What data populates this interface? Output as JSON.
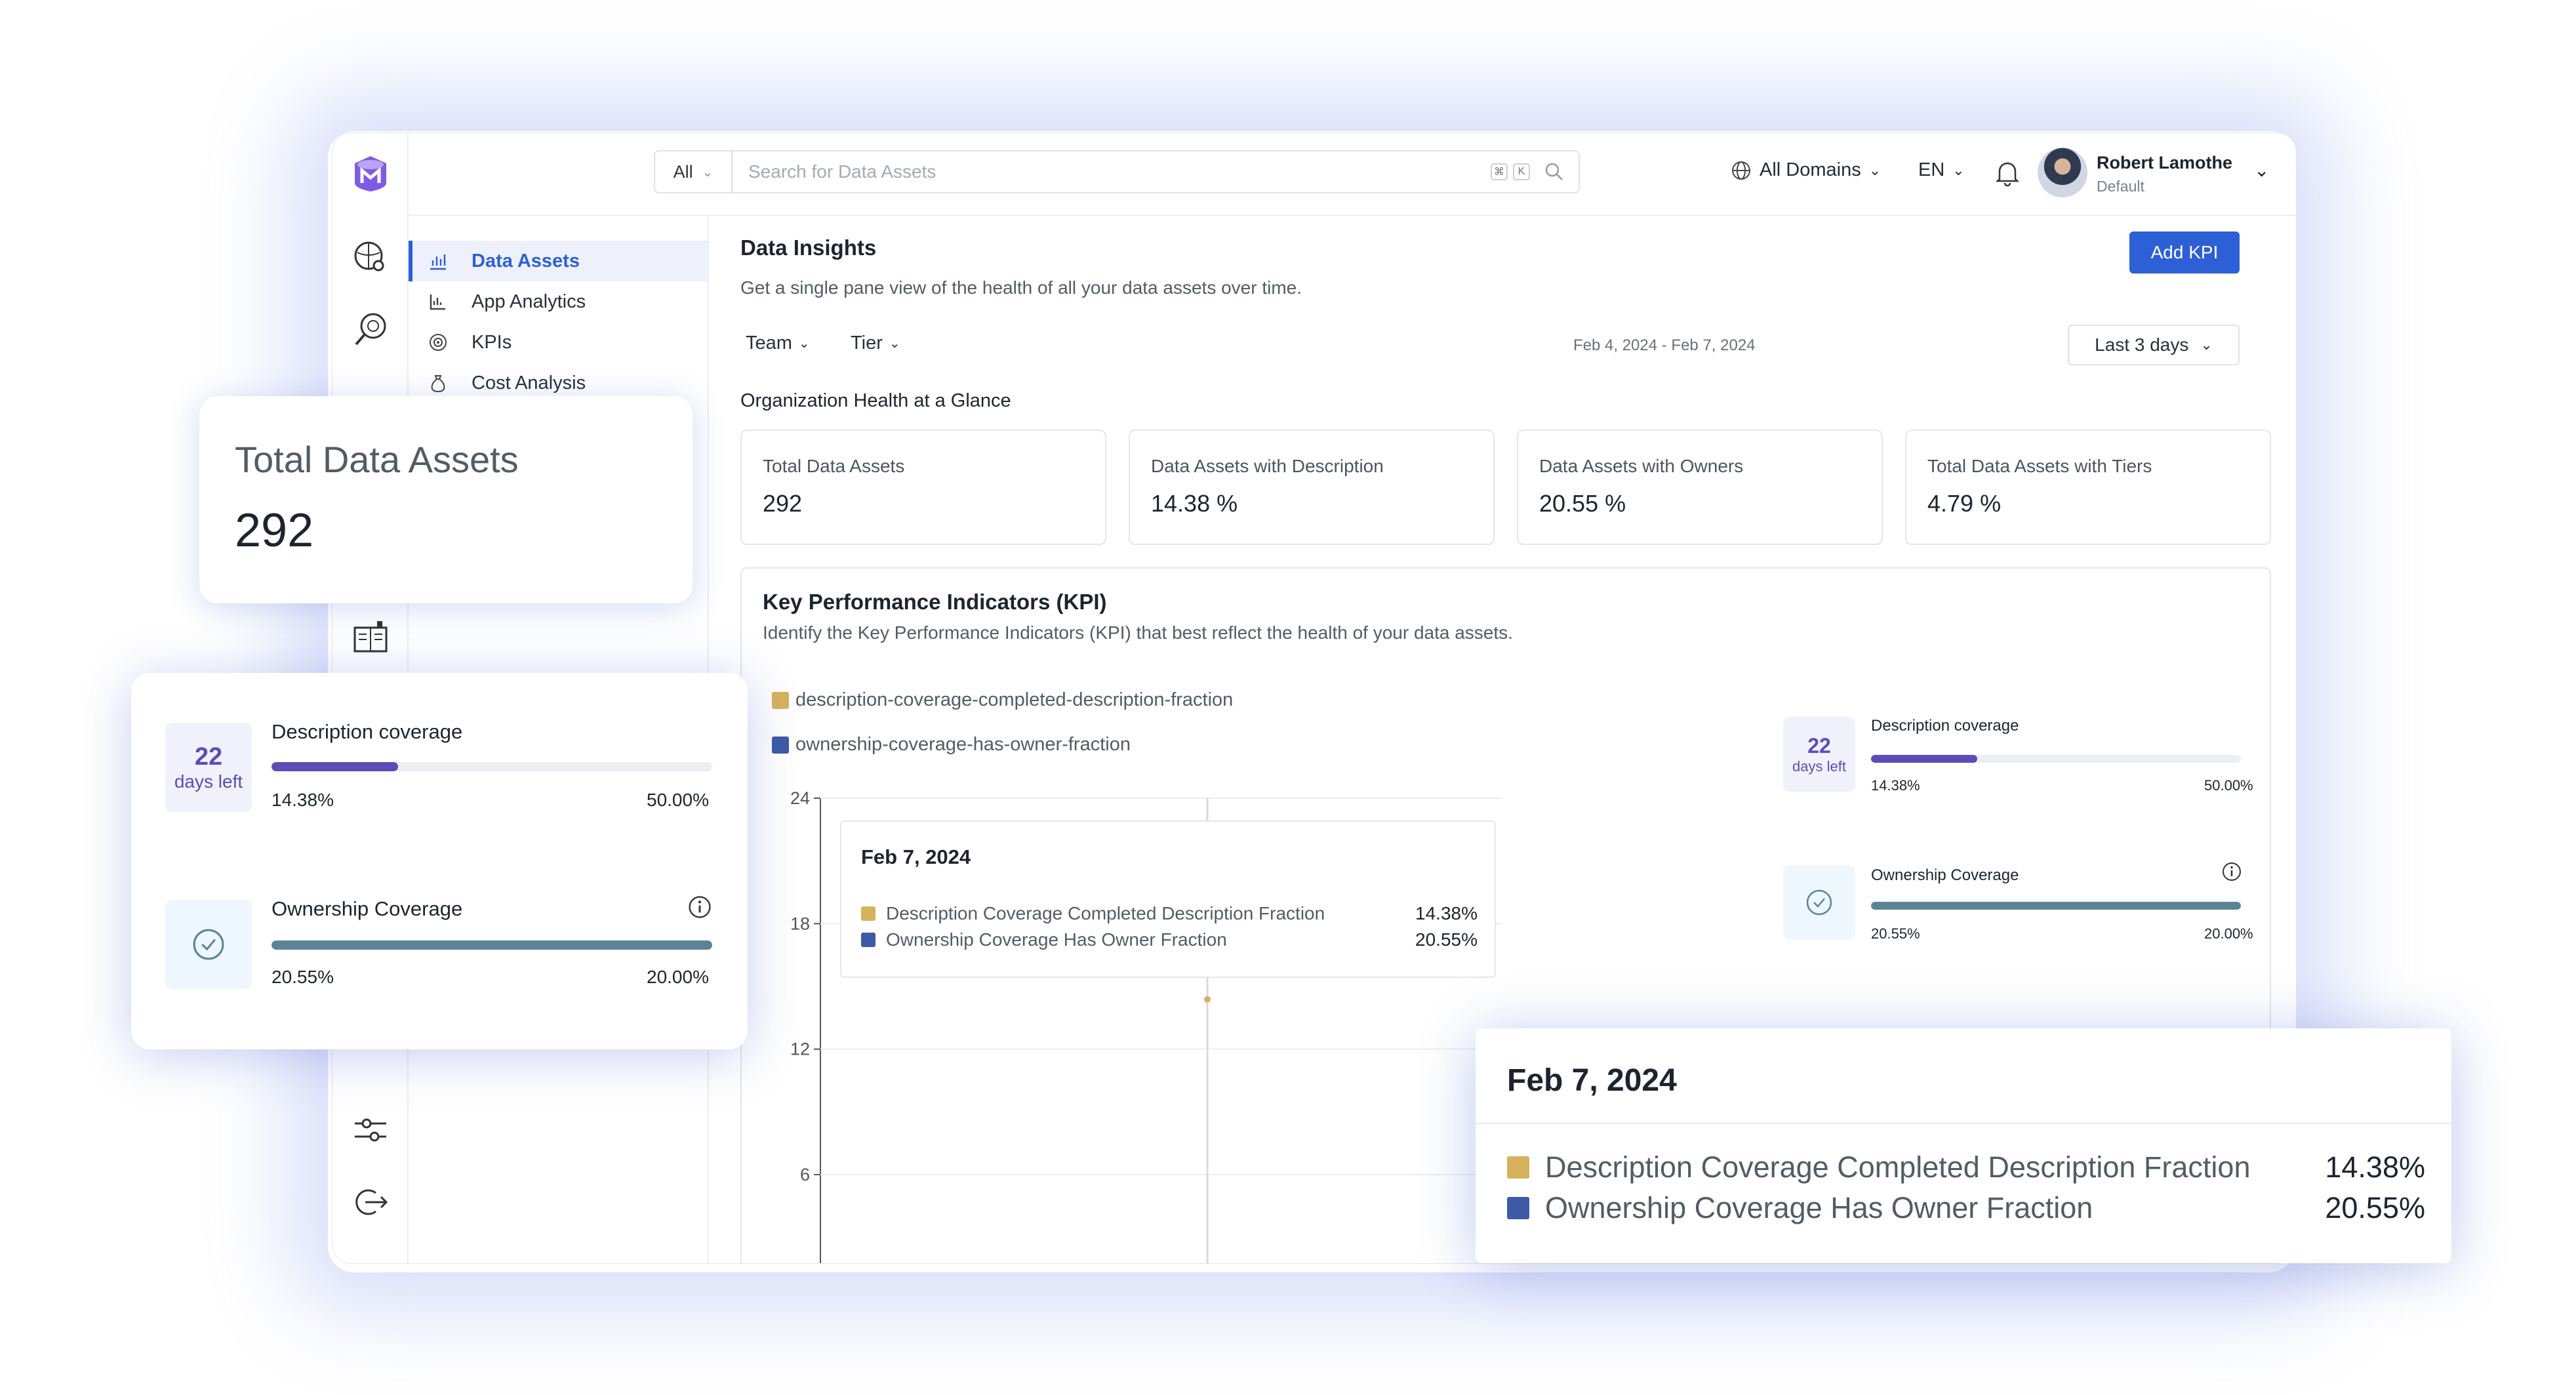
{
  "app": {
    "search": {
      "scope": "All",
      "placeholder": "Search for Data Assets",
      "shortcut_a": "⌘",
      "shortcut_b": "K"
    },
    "topbar": {
      "domains": "All Domains",
      "language": "EN",
      "user_name": "Robert Lamothe",
      "user_role": "Default"
    },
    "subnav": [
      "Data Assets",
      "App Analytics",
      "KPIs",
      "Cost Analysis"
    ],
    "main": {
      "title": "Data Insights",
      "subtitle": "Get a single pane view of the health of all your data assets over time.",
      "add_kpi": "Add KPI",
      "filters": [
        "Team",
        "Tier"
      ],
      "date_range": "Feb 4, 2024 - Feb 7, 2024",
      "period": "Last 3 days",
      "health_title": "Organization Health at a Glance",
      "stats": [
        {
          "label": "Total Data Assets",
          "value": "292"
        },
        {
          "label": "Data Assets with Description",
          "value": "14.38 %"
        },
        {
          "label": "Data Assets with Owners",
          "value": "20.55 %"
        },
        {
          "label": "Total Data Assets with Tiers",
          "value": "4.79 %"
        }
      ],
      "kpi_title": "Key Performance Indicators (KPI)",
      "kpi_subtitle": "Identify the Key Performance Indicators (KPI) that best reflect the health of your data assets.",
      "legend": [
        "description-coverage-completed-description-fraction",
        "ownership-coverage-has-owner-fraction"
      ]
    }
  },
  "kpis": [
    {
      "name": "Description coverage",
      "days": "22",
      "days_label": "days left",
      "current": "14.38%",
      "target": "50.00%",
      "progress": 0.2876,
      "color": "#5c4db6"
    },
    {
      "name": "Ownership Coverage",
      "current": "20.55%",
      "target": "20.00%",
      "progress": 1.0,
      "color": "#5a8496"
    }
  ],
  "overlay_total": {
    "label": "Total Data Assets",
    "value": "292"
  },
  "tooltip": {
    "date": "Feb 7, 2024",
    "rows": [
      {
        "label": "Description Coverage Completed Description Fraction",
        "value": "14.38%"
      },
      {
        "label": "Ownership Coverage Has Owner Fraction",
        "value": "20.55%"
      }
    ]
  },
  "chart_data": {
    "type": "line",
    "x": [
      "Feb 7, 2024"
    ],
    "series": [
      {
        "name": "description-coverage-completed-description-fraction",
        "values": [
          14.38
        ],
        "color": "#d7b25c"
      },
      {
        "name": "ownership-coverage-has-owner-fraction",
        "values": [
          20.55
        ],
        "color": "#3c5aa6"
      }
    ],
    "yticks": [
      "24",
      "18",
      "12",
      "6"
    ],
    "ylim": [
      0,
      24
    ],
    "grid": true
  },
  "colors": {
    "accent": "#2d5fd6",
    "description": "#d7b25c",
    "ownership": "#3c5aa6"
  }
}
